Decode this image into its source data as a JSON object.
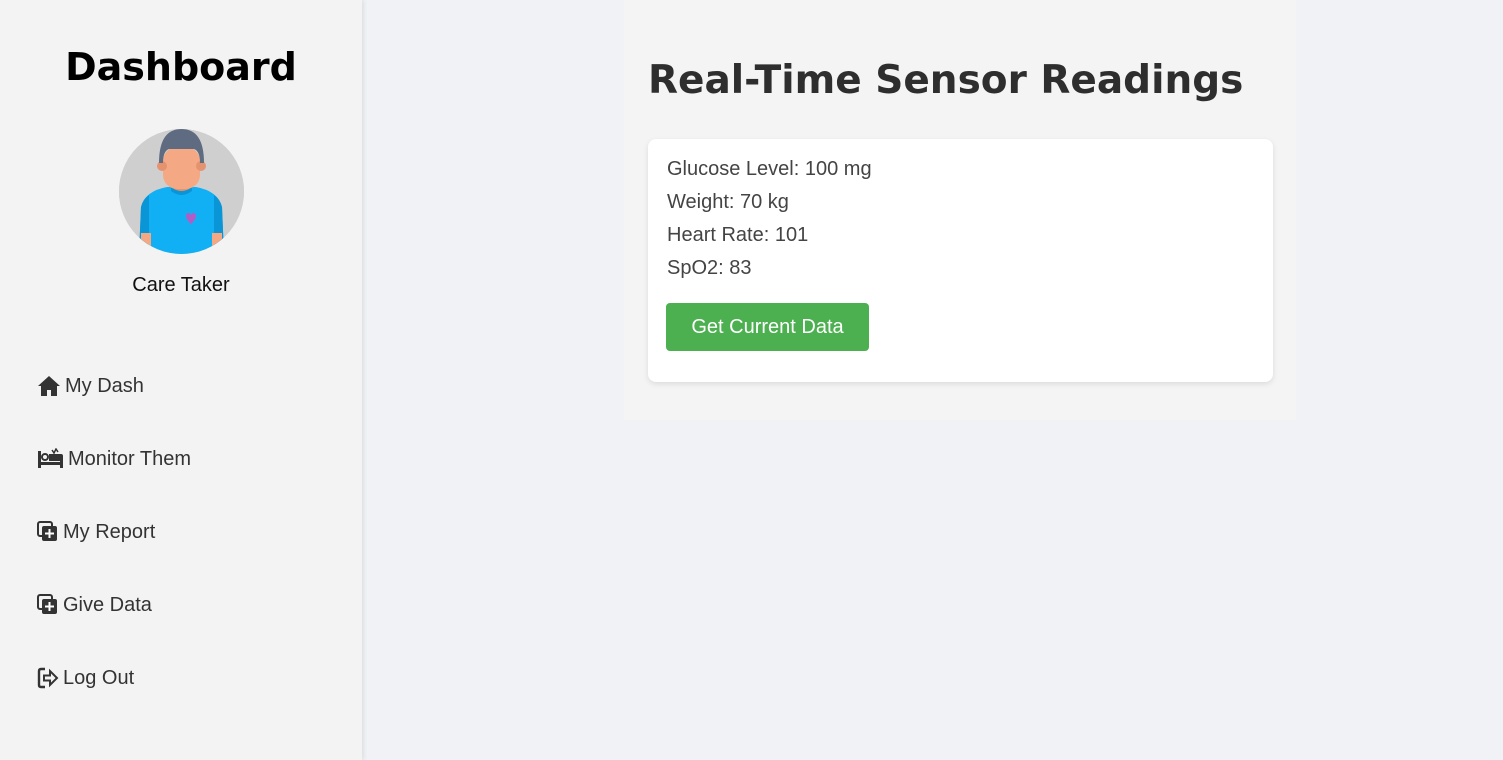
{
  "sidebar": {
    "title": "Dashboard",
    "user": {
      "name": "Care Taker",
      "avatar_icon": "person-heart-avatar"
    },
    "items": [
      {
        "label": "My Dash",
        "icon": "home-icon"
      },
      {
        "label": "Monitor Them",
        "icon": "bed-icon"
      },
      {
        "label": "My Report",
        "icon": "copy-plus-icon"
      },
      {
        "label": "Give Data",
        "icon": "copy-plus-icon"
      },
      {
        "label": "Log Out",
        "icon": "sign-out-icon"
      }
    ]
  },
  "main": {
    "title": "Real-Time Sensor Readings",
    "readings": {
      "glucose": "Glucose Level: 100 mg",
      "weight": "Weight: 70 kg",
      "heart_rate": "Heart Rate: 101",
      "spo2": "SpO2: 83"
    },
    "button_label": "Get Current Data"
  },
  "colors": {
    "button": "#4caf50",
    "page_bg": "#f0f2f5",
    "sidebar_bg": "#f3f3f3",
    "avatar_shirt": "#00aaff"
  }
}
